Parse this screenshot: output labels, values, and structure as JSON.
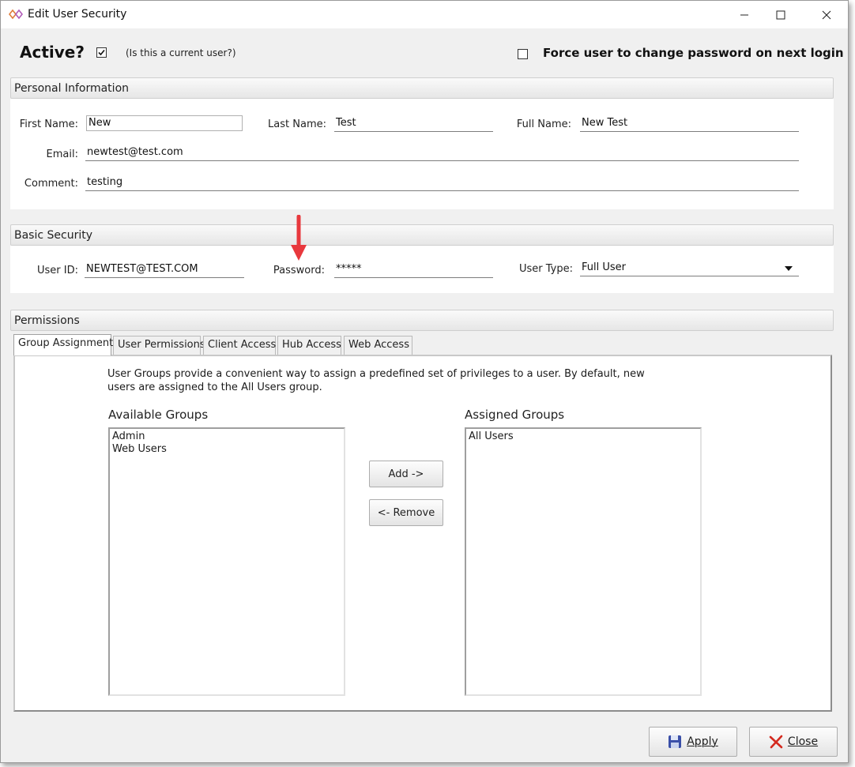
{
  "window": {
    "title": "Edit User Security"
  },
  "top": {
    "active_label": "Active?",
    "active_checked": true,
    "active_hint": "(Is this a current user?)",
    "force_change_label": "Force user to change password on next login",
    "force_change_checked": false
  },
  "personal": {
    "header": "Personal Information",
    "first_name_label": "First Name:",
    "first_name": "New",
    "last_name_label": "Last Name:",
    "last_name": "Test",
    "full_name_label": "Full Name:",
    "full_name": "New Test",
    "email_label": "Email:",
    "email": "newtest@test.com",
    "comment_label": "Comment:",
    "comment": "testing"
  },
  "security": {
    "header": "Basic Security",
    "user_id_label": "User ID:",
    "user_id": "NEWTEST@TEST.COM",
    "password_label": "Password:",
    "password": "*****",
    "user_type_label": "User Type:",
    "user_type": "Full User"
  },
  "permissions": {
    "header": "Permissions",
    "tabs": [
      "Group Assignment",
      "User Permissions",
      "Client Access",
      "Hub Access",
      "Web Access"
    ],
    "description_line1": "User Groups provide a convenient way to assign a predefined set of privileges to a user.  By default, new",
    "description_line2": "users are assigned to the All Users group.",
    "available_title": "Available Groups",
    "available_groups": [
      "Admin",
      "Web Users"
    ],
    "assigned_title": "Assigned Groups",
    "assigned_groups": [
      "All Users"
    ],
    "add_label": "Add ->",
    "remove_label": "<- Remove"
  },
  "footer": {
    "apply_label": "Apply",
    "close_label": "Close"
  },
  "colors": {
    "annotation_arrow": "#e8383d",
    "close_icon": "#d42a1f",
    "apply_icon": "#3a4fa8"
  }
}
